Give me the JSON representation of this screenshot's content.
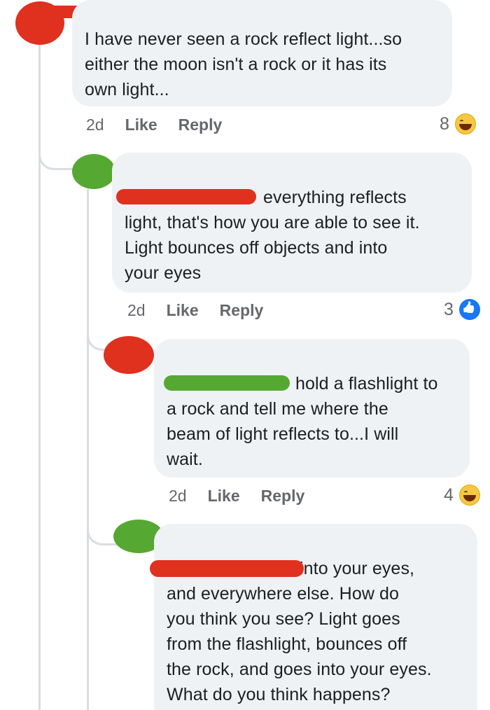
{
  "comments": [
    {
      "author": "",
      "text": "I have never seen a rock reflect light...so\neither the moon isn't a rock or it has its\nown light...",
      "time": "2d",
      "like_label": "Like",
      "reply_label": "Reply",
      "reaction_count": "8",
      "reaction_icon": "haha-reaction-icon"
    },
    {
      "author": "",
      "text": "everything reflects\nlight, that's how you are able to see it.\nLight bounces off objects and into\nyour eyes",
      "time": "2d",
      "like_label": "Like",
      "reply_label": "Reply",
      "reaction_count": "3",
      "reaction_icon": "like-reaction-icon"
    },
    {
      "author": "",
      "text": "hold a flashlight to\na rock and tell me where the\nbeam of light reflects to...I will\nwait.",
      "time": "2d",
      "like_label": "Like",
      "reply_label": "Reply",
      "reaction_count": "4",
      "reaction_icon": "haha-reaction-icon"
    },
    {
      "author": "",
      "text": "into your eyes,\nand everywhere else.  How do\nyou think you see?  Light goes\nfrom the flashlight, bounces off\nthe rock, and goes into your eyes.\nWhat do you think happens?"
    }
  ],
  "colors": {
    "bubble": "#eff2f5",
    "redaction_red": "#e0301e",
    "redaction_green": "#55a832",
    "meta_gray": "#65676b"
  }
}
